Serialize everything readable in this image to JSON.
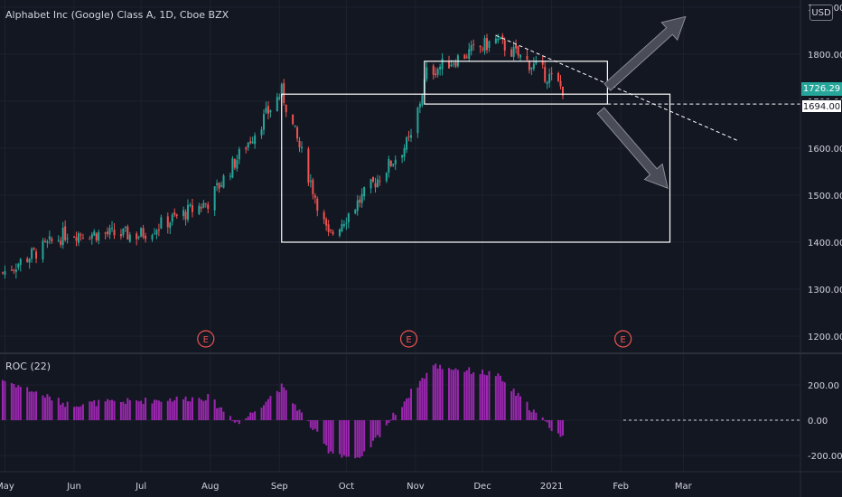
{
  "header": {
    "title": "Alphabet Inc (Google) Class A, 1D, Cboe BZX",
    "currency": "USD"
  },
  "price_tags": {
    "last": "1726.29",
    "level": "1694.00"
  },
  "indicator": {
    "title": "ROC (22)"
  },
  "earnings_marker": "E",
  "colors": {
    "background": "#131722",
    "up": "#26a69a",
    "down": "#ef5350",
    "roc": "#9c27b0",
    "grid": "#1e222d",
    "axis_text": "#d1d4dc",
    "drawing": "#ffffff"
  },
  "chart_data": [
    {
      "type": "candlestick",
      "title": "Alphabet Inc (Google) Class A, 1D, Cboe BZX",
      "x_tick_labels": [
        "May",
        "Jun",
        "Jul",
        "Aug",
        "Sep",
        "Oct",
        "Nov",
        "Dec",
        "2021",
        "Feb",
        "Mar"
      ],
      "y_tick_labels": [
        "1200.00",
        "1300.00",
        "1400.00",
        "1500.00",
        "1600.00",
        "1700.00",
        "1800.00",
        "1900.00"
      ],
      "ylim": [
        1170,
        1900
      ],
      "grid": true,
      "key_points": [
        {
          "date": "2020-04-30",
          "close": 1335
        },
        {
          "date": "2020-05-29",
          "close": 1420
        },
        {
          "date": "2020-06-30",
          "close": 1415
        },
        {
          "date": "2020-07-31",
          "close": 1485
        },
        {
          "date": "2020-09-02",
          "close": 1720
        },
        {
          "date": "2020-09-23",
          "close": 1410
        },
        {
          "date": "2020-10-30",
          "close": 1620
        },
        {
          "date": "2020-11-06",
          "close": 1760
        },
        {
          "date": "2020-12-07",
          "close": 1830
        },
        {
          "date": "2020-12-31",
          "close": 1751
        },
        {
          "date": "2021-01-06",
          "close": 1726.29
        }
      ],
      "last_price": 1726.29,
      "horizontal_level": 1694.0,
      "earnings_events": [
        "2020-07-30",
        "2020-10-29",
        "2021-02-02"
      ],
      "drawings": [
        {
          "kind": "rectangle",
          "from": "2020-09-02",
          "to": "2021-02-23",
          "price_from": 1400,
          "price_to": 1715
        },
        {
          "kind": "rectangle",
          "from": "2020-11-05",
          "to": "2021-01-26",
          "price_from": 1694,
          "price_to": 1785
        },
        {
          "kind": "trend_line",
          "from": "2020-12-07",
          "price_from": 1840,
          "to": "2021-03-25",
          "price_to": 1617,
          "style": "dashed"
        },
        {
          "kind": "horizontal_ray",
          "from": "2021-01-26",
          "price": 1694,
          "style": "dashed"
        },
        {
          "kind": "arrow",
          "direction": "up",
          "from": "2021-01-26",
          "price_from": 1730,
          "to": "2021-03-02",
          "price_to": 1880
        },
        {
          "kind": "arrow",
          "direction": "down",
          "from": "2021-01-23",
          "price_from": 1680,
          "to": "2021-02-22",
          "price_to": 1515
        }
      ]
    },
    {
      "type": "bar",
      "title": "ROC (22)",
      "y_tick_labels": [
        "200.00",
        "0.00",
        "-200.00"
      ],
      "ylim": [
        -270,
        320
      ],
      "zero_line": "dashed",
      "key_points": [
        {
          "date": "2020-04-30",
          "value": 230
        },
        {
          "date": "2020-05-29",
          "value": 90
        },
        {
          "date": "2020-06-30",
          "value": 110
        },
        {
          "date": "2020-07-31",
          "value": 130
        },
        {
          "date": "2020-08-14",
          "value": -20
        },
        {
          "date": "2020-09-02",
          "value": 190
        },
        {
          "date": "2020-09-23",
          "value": -170
        },
        {
          "date": "2020-10-07",
          "value": -230
        },
        {
          "date": "2020-10-30",
          "value": 160
        },
        {
          "date": "2020-11-09",
          "value": 310
        },
        {
          "date": "2020-12-07",
          "value": 260
        },
        {
          "date": "2020-12-31",
          "value": -35
        },
        {
          "date": "2021-01-06",
          "value": -100
        }
      ]
    }
  ]
}
